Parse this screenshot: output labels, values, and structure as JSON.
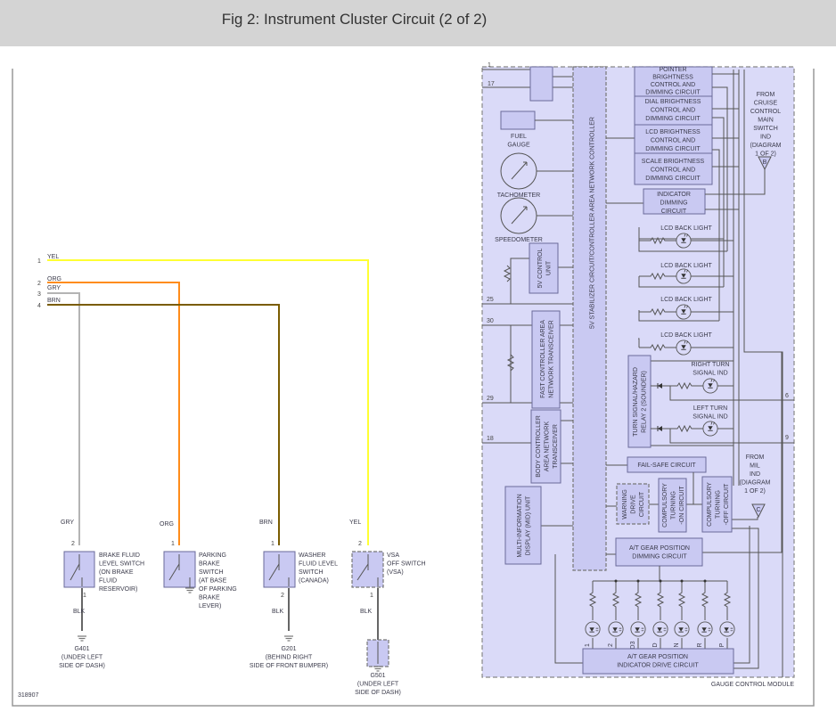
{
  "title": "Fig 2: Instrument Cluster Circuit (2 of 2)",
  "diagram_id": "318907",
  "colors": {
    "yel": "#ffff33",
    "org": "#ff8c1a",
    "gry": "#b4b4b4",
    "brn": "#7a5c00",
    "blk": "#666666",
    "module_fill": "#dadaf8",
    "box_fill": "#c9c9f2"
  },
  "connector": [
    {
      "pin": "1",
      "wire": "YEL"
    },
    {
      "pin": "2",
      "wire": "ORG"
    },
    {
      "pin": "3",
      "wire": "GRY"
    },
    {
      "pin": "4",
      "wire": "BRN"
    }
  ],
  "switches": [
    {
      "wire": "GRY",
      "top_pin": "2",
      "bottom_pin": "1",
      "ground_wire": "BLK",
      "label": [
        "BRAKE FLUID",
        "LEVEL SWITCH",
        "(ON BRAKE",
        "FLUID",
        "RESERVOIR)"
      ],
      "ground": [
        "G401",
        "(UNDER LEFT",
        "SIDE OF DASH)"
      ]
    },
    {
      "wire": "ORG",
      "top_pin": "1",
      "label": [
        "PARKING",
        "BRAKE",
        "SWITCH",
        "(AT BASE",
        "OF PARKING",
        "BRAKE",
        "LEVER)"
      ]
    },
    {
      "wire": "BRN",
      "top_pin": "1",
      "bottom_pin": "2",
      "ground_wire": "BLK",
      "label": [
        "WASHER",
        "FLUID LEVEL",
        "SWITCH",
        "(CANADA)"
      ],
      "ground": [
        "G201",
        "(BEHIND RIGHT",
        "SIDE OF FRONT BUMPER)"
      ]
    },
    {
      "wire": "YEL",
      "top_pin": "2",
      "bottom_pin": "1",
      "ground_wire": "BLK",
      "label": [
        "VSA",
        "OFF SWITCH",
        "(VSA)"
      ],
      "ground": [
        "G501",
        "(UNDER LEFT",
        "SIDE OF DASH)"
      ]
    }
  ],
  "module": {
    "name": "GAUGE CONTROL MODULE",
    "pins_left": [
      "1",
      "17",
      "25",
      "30",
      "29",
      "18"
    ],
    "pins_right": [
      "6",
      "9"
    ],
    "fuel_gauge": [
      "FUEL",
      "GAUGE"
    ],
    "tachometer": "TACHOMETER",
    "speedometer": "SPEEDOMETER",
    "control_unit_5v": [
      "5V CONTROL",
      "UNIT"
    ],
    "stabilizer": [
      "5V STABILIZER CIRCUIT/CONTROLLER AREA NETWORK CONTROLLER"
    ],
    "fast_can": [
      "FAST CONTROLLER AREA",
      "NETWORK TRANSCEIVER"
    ],
    "body_can": [
      "BODY CONTROLLER",
      "AREA NETWORK",
      "TRANSCEIVER"
    ],
    "mid_unit": [
      "MULTI-INFORMATION",
      "DISPLAY (MID) UNIT"
    ],
    "pointer": [
      "POINTER",
      "BRIGHTNESS",
      "CONTROL AND",
      "DIMMING CIRCUIT"
    ],
    "dial": [
      "DIAL BRIGHTNESS",
      "CONTROL AND",
      "DIMMING CIRCUIT"
    ],
    "lcd": [
      "LCD BRIGHTNESS",
      "CONTROL AND",
      "DIMMING CIRCUIT"
    ],
    "scale": [
      "SCALE BRIGHTNESS",
      "CONTROL AND",
      "DIMMING CIRCUIT"
    ],
    "indicator_dimming": [
      "INDICATOR",
      "DIMMING",
      "CIRCUIT"
    ],
    "lcd_back_light": "LCD BACK LIGHT",
    "turn_relay": [
      "TURN SIGNAL/HAZARD",
      "RELAY 2 (SOUNDER)"
    ],
    "right_turn": [
      "RIGHT TURN",
      "SIGNAL IND"
    ],
    "left_turn": [
      "LEFT TURN",
      "SIGNAL IND"
    ],
    "fail_safe": "FAIL-SAFE   CIRCUIT",
    "warning_drive": [
      "WARNING",
      "DRIVE",
      "CIRCUIT"
    ],
    "comp_on": [
      "COMPULSORY",
      "TURNING",
      "-ON CIRCUIT"
    ],
    "comp_off": [
      "COMPULSORY",
      "TURNING",
      "-OFF CIRCUIT"
    ],
    "from_cruise": [
      "FROM",
      "CRUISE",
      "CONTROL",
      "MAIN",
      "SWITCH",
      "IND",
      "(DIAGRAM",
      "1 OF 2)"
    ],
    "cruise_ref": "B",
    "from_mil": [
      "FROM",
      "MIL",
      "IND",
      "(DIAGRAM",
      "1 OF 2)"
    ],
    "mil_ref": "C",
    "gear_dimming": [
      "A/T GEAR POSITION",
      "DIMMING CIRCUIT"
    ],
    "gear_drive": [
      "A/T GEAR POSITION",
      "INDICATOR DRIVE CIRCUIT"
    ],
    "gear_positions": [
      "1",
      "2",
      "D3",
      "D",
      "N",
      "R",
      "P"
    ]
  }
}
